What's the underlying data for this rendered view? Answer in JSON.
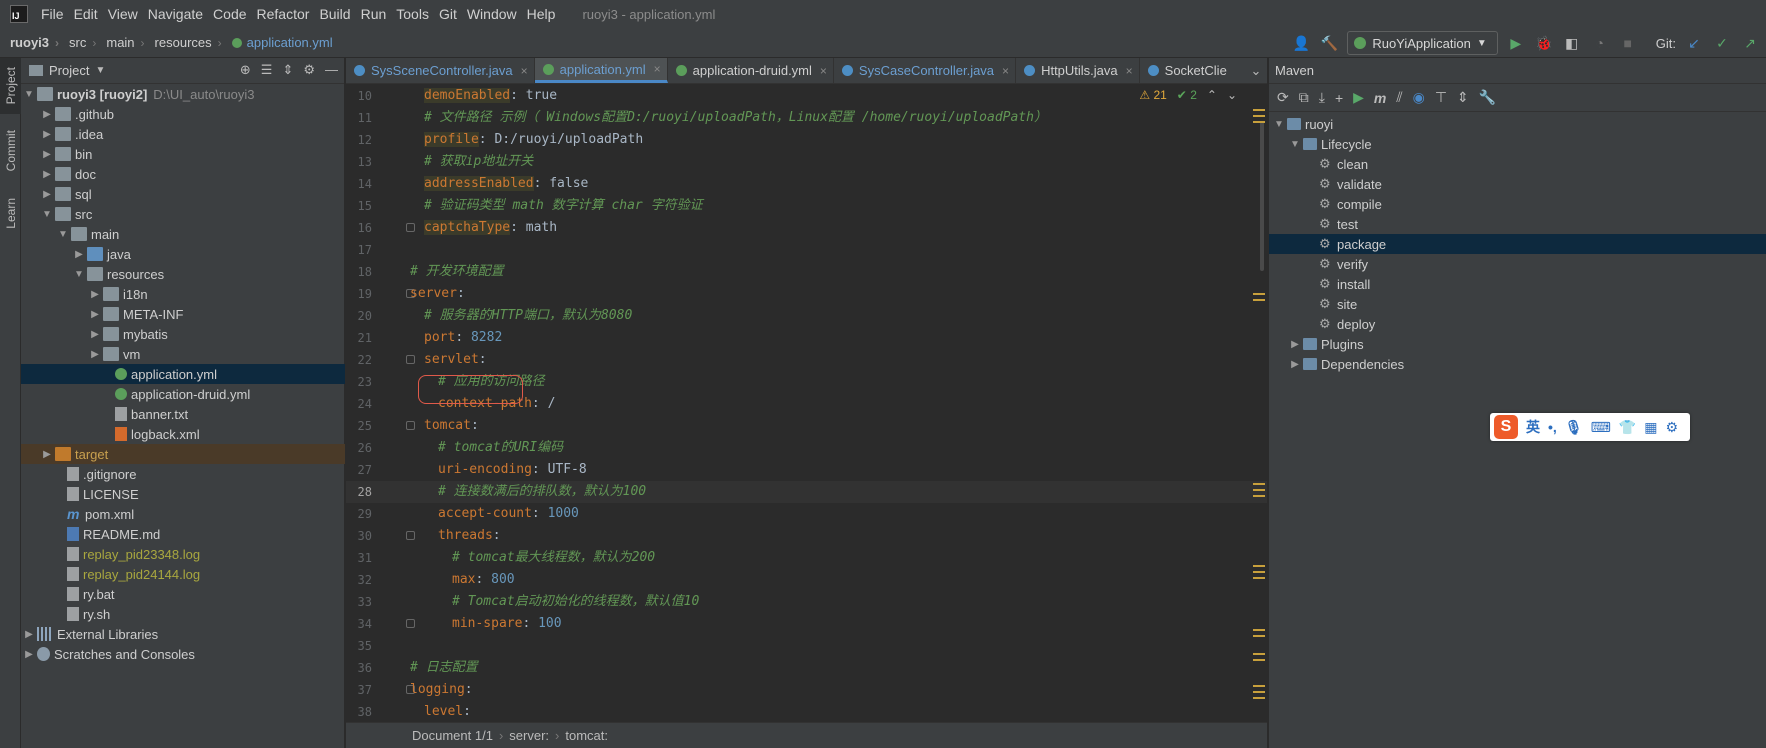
{
  "menubar": {
    "logo_text": "IJ",
    "items": [
      "File",
      "Edit",
      "View",
      "Navigate",
      "Code",
      "Refactor",
      "Build",
      "Run",
      "Tools",
      "Git",
      "Window",
      "Help"
    ],
    "window_title": "ruoyi3 - application.yml"
  },
  "navbar": {
    "breadcrumbs": [
      "ruoyi3",
      "src",
      "main",
      "resources",
      "application.yml"
    ],
    "run_config": "RuoYiApplication",
    "git_label": "Git:"
  },
  "left_strip": {
    "tabs": [
      "Project",
      "Commit",
      "Learn"
    ]
  },
  "project": {
    "title": "Project",
    "tree": [
      {
        "label": "ruoyi3 [ruoyi2]",
        "hint": "D:\\UI_auto\\ruoyi3"
      },
      {
        "label": ".github"
      },
      {
        "label": ".idea"
      },
      {
        "label": "bin"
      },
      {
        "label": "doc"
      },
      {
        "label": "sql"
      },
      {
        "label": "src"
      },
      {
        "label": "main"
      },
      {
        "label": "java"
      },
      {
        "label": "resources"
      },
      {
        "label": "i18n"
      },
      {
        "label": "META-INF"
      },
      {
        "label": "mybatis"
      },
      {
        "label": "vm"
      },
      {
        "label": "application.yml"
      },
      {
        "label": "application-druid.yml"
      },
      {
        "label": "banner.txt"
      },
      {
        "label": "logback.xml"
      },
      {
        "label": "target"
      },
      {
        "label": ".gitignore"
      },
      {
        "label": "LICENSE"
      },
      {
        "label": "pom.xml"
      },
      {
        "label": "README.md"
      },
      {
        "label": "replay_pid23348.log"
      },
      {
        "label": "replay_pid24144.log"
      },
      {
        "label": "ry.bat"
      },
      {
        "label": "ry.sh"
      },
      {
        "label": "External Libraries"
      },
      {
        "label": "Scratches and Consoles"
      }
    ]
  },
  "editor": {
    "tabs": [
      {
        "label": "SysSceneController.java"
      },
      {
        "label": "application.yml"
      },
      {
        "label": "application-druid.yml"
      },
      {
        "label": "SysCaseController.java"
      },
      {
        "label": "HttpUtils.java"
      },
      {
        "label": "SocketClie"
      }
    ],
    "inspection": {
      "warnings": "21",
      "ok": "2"
    },
    "lines": [
      {
        "n": "10",
        "key": "demoEnabled",
        "val": " true"
      },
      {
        "n": "11",
        "comment": "# 文件路径 示例（ Windows配置D:/ruoyi/uploadPath，Linux配置 /home/ruoyi/uploadPath）"
      },
      {
        "n": "12",
        "key": "profile",
        "val": " D:/ruoyi/uploadPath"
      },
      {
        "n": "13",
        "comment": "# 获取ip地址开关"
      },
      {
        "n": "14",
        "key": "addressEnabled",
        "val": " false"
      },
      {
        "n": "15",
        "comment": "# 验证码类型 math 数字计算 char 字符验证"
      },
      {
        "n": "16",
        "key": "captchaType",
        "val": " math"
      },
      {
        "n": "17"
      },
      {
        "n": "18",
        "comment": "# 开发环境配置"
      },
      {
        "n": "19",
        "key": "server"
      },
      {
        "n": "20",
        "comment": "# 服务器的HTTP端口，默认为8080"
      },
      {
        "n": "21",
        "key": "port",
        "num": " 8282"
      },
      {
        "n": "22",
        "key": "servlet"
      },
      {
        "n": "23",
        "comment": "# 应用的访问路径"
      },
      {
        "n": "24",
        "key": "context-path",
        "val": " /"
      },
      {
        "n": "25",
        "key": "tomcat"
      },
      {
        "n": "26",
        "comment": "# tomcat的URI编码"
      },
      {
        "n": "27",
        "key": "uri-encoding",
        "val": " UTF-8"
      },
      {
        "n": "28",
        "comment": "# 连接数满后的排队数，默认为100"
      },
      {
        "n": "29",
        "key": "accept-count",
        "num": " 1000"
      },
      {
        "n": "30",
        "key": "threads"
      },
      {
        "n": "31",
        "comment": "# tomcat最大线程数，默认为200"
      },
      {
        "n": "32",
        "key": "max",
        "num": " 800"
      },
      {
        "n": "33",
        "comment": "# Tomcat启动初始化的线程数，默认值10"
      },
      {
        "n": "34",
        "key": "min-spare",
        "num": " 100"
      },
      {
        "n": "35"
      },
      {
        "n": "36",
        "comment": "# 日志配置"
      },
      {
        "n": "37",
        "key": "logging"
      },
      {
        "n": "38",
        "key": "level"
      }
    ],
    "colon": ":",
    "status": [
      "Document 1/1",
      "server:",
      "tomcat:"
    ]
  },
  "maven": {
    "title": "Maven",
    "tree": [
      {
        "label": "ruoyi"
      },
      {
        "label": "Lifecycle"
      },
      {
        "label": "clean"
      },
      {
        "label": "validate"
      },
      {
        "label": "compile"
      },
      {
        "label": "test"
      },
      {
        "label": "package"
      },
      {
        "label": "verify"
      },
      {
        "label": "install"
      },
      {
        "label": "site"
      },
      {
        "label": "deploy"
      },
      {
        "label": "Plugins"
      },
      {
        "label": "Dependencies"
      }
    ]
  },
  "ime": {
    "logo": "S",
    "mode": "英"
  },
  "colors": {
    "accent": "#4a88c7",
    "selection": "#0d293e",
    "highlight_box": "#e05a4a"
  }
}
